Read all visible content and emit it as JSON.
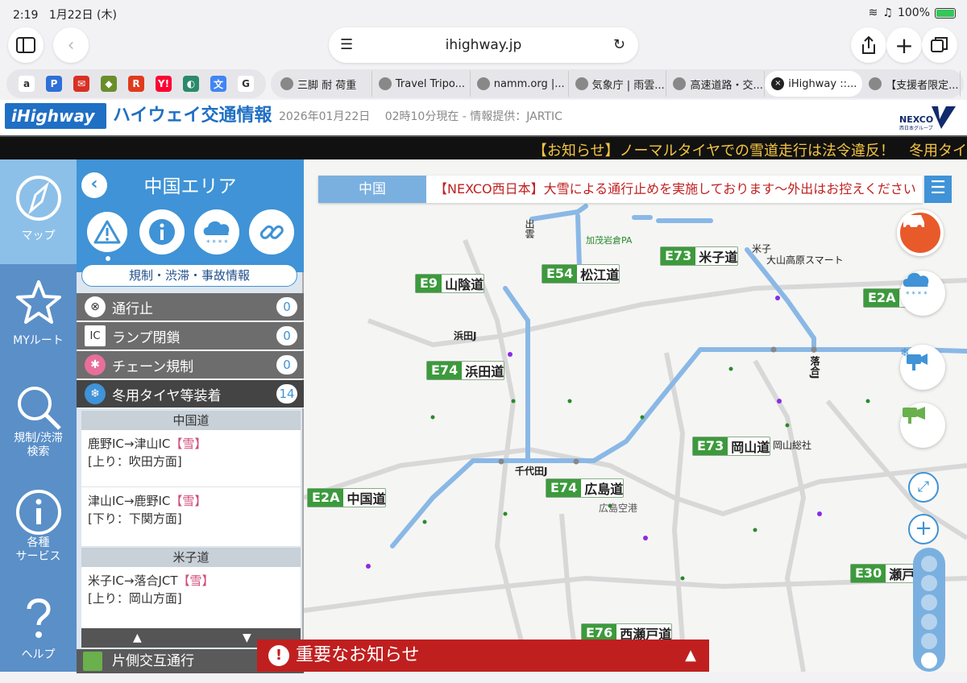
{
  "status": {
    "time": "2:19",
    "date": "1月22日 (木)",
    "battery": "100%",
    "battery_level": 1.0
  },
  "browser": {
    "url": "ihighway.jp",
    "favorites": [
      {
        "icon": "amazon-icon",
        "glyph": "a",
        "color": "#ffffff"
      },
      {
        "icon": "pixiv-icon",
        "glyph": "P",
        "color": "#2e6fd8"
      },
      {
        "icon": "gmail-icon",
        "glyph": "✉",
        "color": "#d93025"
      },
      {
        "icon": "shopping-icon",
        "glyph": "◆",
        "color": "#6a8e2a"
      },
      {
        "icon": "rakuten-icon",
        "glyph": "R",
        "color": "#e03a1e"
      },
      {
        "icon": "yahoo-icon",
        "glyph": "Y!",
        "color": "#ff0033"
      },
      {
        "icon": "cloud-icon",
        "glyph": "◐",
        "color": "#2a8a6a"
      },
      {
        "icon": "translate-icon",
        "glyph": "文",
        "color": "#4285f4"
      },
      {
        "icon": "google-icon",
        "glyph": "G",
        "color": "#ffffff"
      }
    ],
    "tabs": [
      {
        "title": "三脚 耐 荷重",
        "icon": "orange-square-icon",
        "active": false
      },
      {
        "title": "Travel Tripo...",
        "icon": "camera-icon",
        "active": false
      },
      {
        "title": "namm.org |...",
        "icon": "globe-icon",
        "active": false
      },
      {
        "title": "気象庁 | 雨雲...",
        "icon": "weather-icon",
        "active": false
      },
      {
        "title": "高速道路・交...",
        "icon": "highway-icon",
        "active": false
      },
      {
        "title": "iHighway ::...",
        "icon": "close-icon",
        "active": true
      },
      {
        "title": "【支援者限定...",
        "icon": "character-icon",
        "active": false
      }
    ]
  },
  "site": {
    "logo_text": "iHighway",
    "title": "ハイウェイ交通情報",
    "datetime": "2026年01月22日　 02時10分現在 - 情報提供：JARTIC",
    "nexco_text": "NEXCO",
    "nexco_sub": "西日本グループ",
    "ticker": "【お知らせ】ノーマルタイヤでの雪道走行は法令違反！　冬用タイ"
  },
  "sidebar": {
    "items": [
      {
        "label": "マップ",
        "icon": "compass-icon",
        "selected": true
      },
      {
        "label": "MYルート",
        "icon": "star-icon",
        "selected": false
      },
      {
        "label": "規制/渋滞\n検索",
        "icon": "search-icon",
        "selected": false
      },
      {
        "label": "各種\nサービス",
        "icon": "info-icon",
        "selected": false
      },
      {
        "label": "ヘルプ",
        "icon": "help-icon",
        "selected": false
      }
    ]
  },
  "panel": {
    "title": "中国エリア",
    "category_button": "規制・渋滞・事故情報",
    "filters": [
      {
        "label": "通行止",
        "count": "0",
        "icon": "closed-road-icon"
      },
      {
        "label": "ランプ閉鎖",
        "count": "0",
        "icon": "ramp-closed-icon"
      },
      {
        "label": "チェーン規制",
        "count": "0",
        "icon": "chain-icon"
      },
      {
        "label": "冬用タイヤ等装着",
        "count": "14",
        "icon": "snow-tire-icon"
      }
    ],
    "sections": [
      {
        "road": "中国道",
        "entries": [
          {
            "route": "鹿野IC→津山IC",
            "tag": "【雪】",
            "direction": "[上り：吹田方面]"
          },
          {
            "route": "津山IC→鹿野IC",
            "tag": "【雪】",
            "direction": "[下り：下関方面]"
          }
        ]
      },
      {
        "road": "米子道",
        "entries": [
          {
            "route": "米子IC→落合JCT",
            "tag": "【雪】",
            "direction": "[上り：岡山方面]"
          }
        ]
      }
    ],
    "scroll_up": "▲",
    "scroll_down": "▼",
    "next_item": "片側交互通行"
  },
  "map": {
    "area_label": "中国",
    "announcement": "【NEXCO西日本】大雪による通行止めを実施しております〜外出はお控えください",
    "routes": [
      {
        "code": "E9",
        "name": "山陰道"
      },
      {
        "code": "E54",
        "name": "松江道"
      },
      {
        "code": "E73",
        "name": "米子道"
      },
      {
        "code": "E2A",
        "name": "二"
      },
      {
        "code": "E74",
        "name": "浜田道"
      },
      {
        "code": "E73",
        "name": "岡山道"
      },
      {
        "code": "E74",
        "name": "広島道"
      },
      {
        "code": "E2A",
        "name": "中国道"
      },
      {
        "code": "E30",
        "name": "瀬戸"
      },
      {
        "code": "E76",
        "name": "西瀬戸道"
      }
    ],
    "labels": {
      "hamada_j": "浜田J",
      "chiyoda_j": "千代田J",
      "hiroshima_airport": "広島空港",
      "daisen_smart": "大山高原スマート",
      "yonago": "米子",
      "izumo": "出雲",
      "kanaya": "加茂岩倉PA",
      "ochiai": "落合J",
      "okayama_sokan": "岡山総社"
    },
    "zoom_level": 5
  },
  "notice": {
    "label": "重要なお知らせ",
    "toggle": "▲"
  },
  "colors": {
    "accent": "#3f93d6",
    "road_active": "#8ab8e6",
    "road_green": "#3c9a3c",
    "notice_red": "#c01f1f",
    "ticker_text": "#f4c542"
  }
}
